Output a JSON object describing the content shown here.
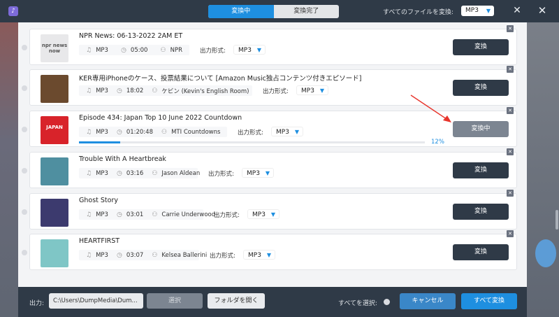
{
  "header": {
    "tabs": [
      {
        "label": "変換中",
        "active": true
      },
      {
        "label": "変換完了",
        "active": false
      }
    ],
    "convert_all_label": "すべてのファイルを変換:",
    "convert_all_format": "MP3"
  },
  "output_label": "出力形式:",
  "items": [
    {
      "title": "NPR News: 06-13-2022 2AM ET",
      "format": "MP3",
      "duration": "05:00",
      "artist": "NPR",
      "output_format": "MP3",
      "button": "変換",
      "thumb_color": "#e8e8ea",
      "thumb_text": "npr news now"
    },
    {
      "title": "KER専用iPhoneのケース、投票結果について [Amazon Music独占コンテンツ付きエピソード]",
      "format": "MP3",
      "duration": "18:02",
      "artist": "ケビン (Kevin's English Room)",
      "output_format": "MP3",
      "button": "変換",
      "thumb_color": "#6b4a2e",
      "thumb_text": ""
    },
    {
      "title": "Episode 434: Japan Top 10 June 2022 Countdown",
      "format": "MP3",
      "duration": "01:20:48",
      "artist": "MTI Countdowns",
      "output_format": "MP3",
      "button": "変換中",
      "progress": 0.12,
      "progress_text": "12%",
      "thumb_color": "#d8232a",
      "thumb_text": "JAPAN"
    },
    {
      "title": "Trouble With A Heartbreak",
      "format": "MP3",
      "duration": "03:16",
      "artist": "Jason Aldean",
      "output_format": "MP3",
      "button": "変換",
      "thumb_color": "#4f8fa0",
      "thumb_text": ""
    },
    {
      "title": "Ghost Story",
      "format": "MP3",
      "duration": "03:01",
      "artist": "Carrie Underwood",
      "output_format": "MP3",
      "button": "変換",
      "thumb_color": "#3c3a6e",
      "thumb_text": ""
    },
    {
      "title": "HEARTFIRST",
      "format": "MP3",
      "duration": "03:07",
      "artist": "Kelsea Ballerini",
      "output_format": "MP3",
      "button": "変換",
      "thumb_color": "#7fc6c6",
      "thumb_text": ""
    }
  ],
  "footer": {
    "output_label": "出力:",
    "output_path": "C:\\Users\\DumpMedia\\Dum...",
    "select_button": "選択",
    "open_folder_button": "フォルダを開く",
    "select_all_label": "すべてを選択:",
    "cancel_button": "キャンセル",
    "convert_all_button": "すべて変換"
  },
  "colors": {
    "accent": "#1e8fe0",
    "dark": "#2f3a47",
    "annotation": "#e8352c"
  }
}
